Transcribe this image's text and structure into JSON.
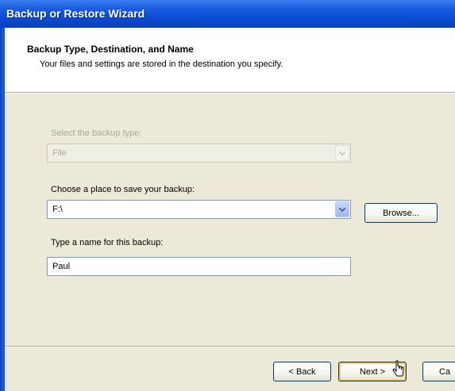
{
  "window": {
    "title": "Backup or Restore Wizard"
  },
  "header": {
    "title": "Backup Type, Destination, and Name",
    "subtitle": "Your files and settings are stored in the destination you specify."
  },
  "backup_type": {
    "label": "Select the backup type:",
    "value": "File",
    "enabled": false
  },
  "destination": {
    "label": "Choose a place to save your backup:",
    "value": "F:\\",
    "browse_label": "Browse..."
  },
  "backup_name": {
    "label": "Type a name for this backup:",
    "value": "Paul"
  },
  "footer": {
    "back_label": "< Back",
    "next_label": "Next >",
    "cancel_label": "Ca"
  },
  "colors": {
    "titlebar": "#0a4fd6",
    "dialog_bg": "#ECE9D8",
    "header_bg": "#FFFFFF",
    "disabled_text": "#ACA899"
  },
  "icons": {
    "dropdown_arrow": "chevron-down-icon",
    "pointer": "mouse-cursor-icon"
  }
}
